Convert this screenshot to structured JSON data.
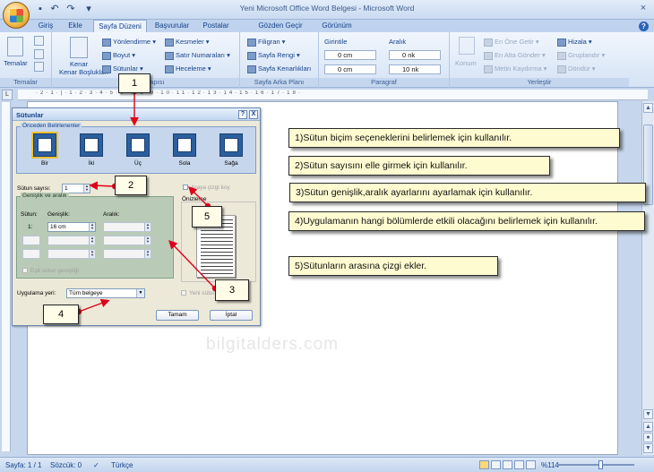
{
  "window": {
    "title": "Yeni Microsoft Office Word Belgesi - Microsoft Word"
  },
  "quick_access": [
    "save-icon",
    "undo-icon",
    "redo-icon",
    "customize-icon"
  ],
  "tabs": [
    {
      "label": "Giriş",
      "active": false
    },
    {
      "label": "Ekle",
      "active": false
    },
    {
      "label": "Sayfa Düzeni",
      "active": true
    },
    {
      "label": "Başvurular",
      "active": false
    },
    {
      "label": "Postalar",
      "active": false
    },
    {
      "label": "Gözden Geçir",
      "active": false
    },
    {
      "label": "Görünüm",
      "active": false
    }
  ],
  "ribbon": {
    "temalar": {
      "label": "Temalar",
      "group": "Temalar"
    },
    "page_setup": {
      "kenar": "Kenar Boşlukları",
      "yonlendirme": "Yönlendirme",
      "boyut": "Boyut",
      "sutunlar": "Sütunlar",
      "kesmeler": "Kesmeler",
      "satir": "Satır Numaraları",
      "heceleme": "Heceleme",
      "group": "Sayfa Yapısı"
    },
    "background": {
      "filigran": "Filigran",
      "rengi": "Sayfa Rengi",
      "kenarlik": "Sayfa Kenarlıkları",
      "group": "Sayfa Arka Planı"
    },
    "paragraph": {
      "girinti": "Girintile",
      "aralik": "Aralık",
      "left_val": "0 cm",
      "right_val": "0 cm",
      "before_val": "0 nk",
      "after_val": "10 nk",
      "group": "Paragraf"
    },
    "arrange": {
      "konum": "Konum",
      "one": "En Öne Getir",
      "alta": "En Alta Gönder",
      "metin": "Metin Kaydırma",
      "hizala": "Hizala",
      "grupla": "Gruplandır",
      "dondur": "Döndür",
      "group": "Yerleştir"
    }
  },
  "dialog": {
    "title": "Sütunlar",
    "help": "?",
    "close": "X",
    "presets_label": "Önceden Belirlenenler",
    "presets": [
      "Bir",
      "İki",
      "Üç",
      "Sola",
      "Sağa"
    ],
    "count_label": "Sütun sayısı:",
    "count_value": "1",
    "line_between": "Araya çizgi koy",
    "preview_label": "Önizleme",
    "widths_label": "Genişlik ve aralık",
    "col_header": "Sütun:",
    "width_header": "Genişlik:",
    "spacing_header": "Aralık:",
    "row_num": "1:",
    "row_width": "16 cm",
    "equal_width": "Eşit sütun genişliği",
    "apply_label": "Uygulama yeri:",
    "apply_value": "Tüm belgeye",
    "new_column": "Yeni sütun",
    "ok": "Tamam",
    "cancel": "İptal"
  },
  "callouts": [
    "1",
    "2",
    "3",
    "4",
    "5"
  ],
  "notes": [
    "1)Sütun biçim seçeneklerini belirlemek için kullanılır.",
    "2)Sütun sayısını elle girmek için kullanılır.",
    "3)Sütun genişlik,aralık ayarlarını ayarlamak için kullanılır.",
    "4)Uygulamanın hangi bölümlerde etkili olacağını belirlemek için kullanılır.",
    "5)Sütunların arasına çizgi ekler."
  ],
  "watermark": "bilgitalders.com",
  "status": {
    "page": "Sayfa: 1 / 1",
    "words": "Sözcük: 0",
    "language": "Türkçe",
    "zoom": "%114"
  },
  "colors": {
    "ribbon": "#d5e3f5",
    "note_bg": "#fffbd1",
    "arrow": "#e0001b"
  }
}
